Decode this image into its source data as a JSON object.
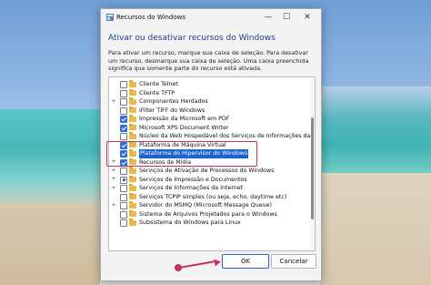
{
  "window": {
    "title": "Recursos do Windows",
    "minimize_glyph": "—",
    "maximize_glyph": "☐",
    "close_glyph": "✕"
  },
  "heading": "Ativar ou desativar recursos do Windows",
  "description": "Para ativar um recurso, marque sua caixa de seleção. Para desativar um recurso, desmarque sua caixa de seleção. Uma caixa preenchida significa que somente parte do recurso está ativada.",
  "features": [
    {
      "label": "Cliente Telnet",
      "expander": "",
      "state": "unchecked"
    },
    {
      "label": "Cliente TFTP",
      "expander": "",
      "state": "unchecked"
    },
    {
      "label": "Componentes Herdados",
      "expander": "+",
      "state": "unchecked"
    },
    {
      "label": "iFilter TIFF do Windows",
      "expander": "",
      "state": "unchecked"
    },
    {
      "label": "Impressão da Microsoft em PDF",
      "expander": "",
      "state": "checked"
    },
    {
      "label": "Microsoft XPS Document Writer",
      "expander": "",
      "state": "checked"
    },
    {
      "label": "Núcleo da Web Hospedável dos Serviços de Informações da",
      "expander": "",
      "state": "unchecked"
    },
    {
      "label": "Plataforma de Máquina Virtual",
      "expander": "",
      "state": "checked"
    },
    {
      "label": "Plataforma do Hipervisor do Windows",
      "expander": "",
      "state": "checked",
      "selected": true
    },
    {
      "label": "Recursos de Mídia",
      "expander": "+",
      "state": "checked"
    },
    {
      "label": "Serviços de Ativação de Processos do Windows",
      "expander": "+",
      "state": "unchecked"
    },
    {
      "label": "Serviços de Impressão e Documentos",
      "expander": "+",
      "state": "partial"
    },
    {
      "label": "Serviços de Informações da Internet",
      "expander": "+",
      "state": "unchecked"
    },
    {
      "label": "Serviços TCPIP simples (ou seja, echo, daytime etc)",
      "expander": "",
      "state": "unchecked"
    },
    {
      "label": "Servidor do MSMQ (Microsoft Message Queue)",
      "expander": "+",
      "state": "unchecked"
    },
    {
      "label": "Sistema de Arquivos Projetados para o Windows",
      "expander": "",
      "state": "unchecked"
    },
    {
      "label": "Subsistema do Windows para Linux",
      "expander": "",
      "state": "unchecked"
    }
  ],
  "buttons": {
    "ok": "OK",
    "cancel": "Cancelar"
  },
  "colors": {
    "accent": "#1b63cf",
    "annotation": "#c9305e"
  }
}
